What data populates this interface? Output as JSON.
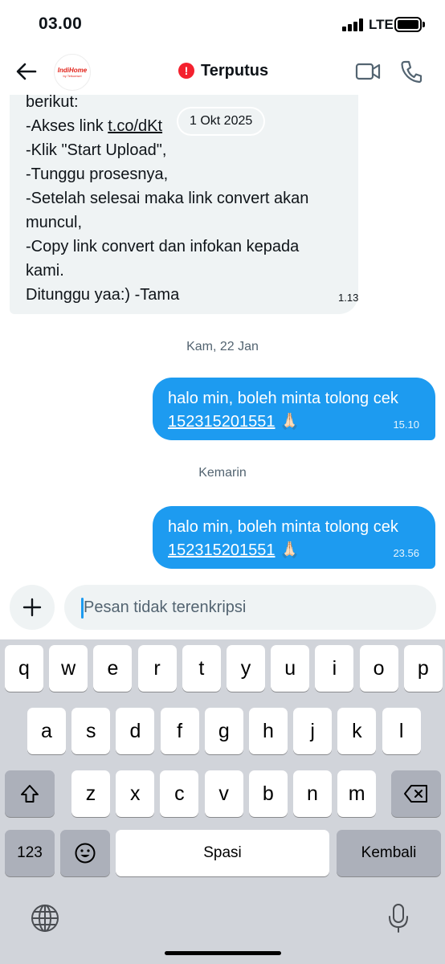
{
  "status_bar": {
    "time": "03.00",
    "network": "LTE"
  },
  "header": {
    "title": "Terputus",
    "avatar_brand": "IndiHome",
    "avatar_sub": "by Telkomsel",
    "back_icon": "arrow-left-icon",
    "video_icon": "video-camera-icon",
    "call_icon": "phone-icon",
    "status_color": "#f4212e"
  },
  "messages": {
    "incoming": {
      "lines": [
        "berikut:",
        "-Akses link ",
        "-Klik \"Start Upload\",",
        "-Tunggu prosesnya,",
        "-Setelah selesai maka link convert akan",
        "muncul,",
        "-Copy link convert dan infokan kepada",
        "kami.",
        "Ditunggu yaa:) -Tama"
      ],
      "link": "t.co/dKt",
      "time": "1.13"
    },
    "date_chip": "1 Okt 2025",
    "day1": "Kam, 22 Jan",
    "out1": {
      "text": "halo min, boleh minta tolong cek",
      "number": "152315201551",
      "emoji": "🙏🏻",
      "time": "15.10"
    },
    "day2": "Kemarin",
    "out2": {
      "text": "halo min, boleh minta tolong cek",
      "number": "152315201551",
      "emoji": "🙏🏻",
      "time": "23.56"
    }
  },
  "composer": {
    "placeholder": "Pesan tidak terenkripsi",
    "plus_icon": "plus-icon"
  },
  "keyboard": {
    "row1": [
      "q",
      "w",
      "e",
      "r",
      "t",
      "y",
      "u",
      "i",
      "o",
      "p"
    ],
    "row2": [
      "a",
      "s",
      "d",
      "f",
      "g",
      "h",
      "j",
      "k",
      "l"
    ],
    "row3": [
      "z",
      "x",
      "c",
      "v",
      "b",
      "n",
      "m"
    ],
    "numbers_key": "123",
    "space_key": "Spasi",
    "return_key": "Kembali",
    "shift_icon": "shift-icon",
    "backspace_icon": "backspace-icon",
    "emoji_icon": "emoji-icon",
    "globe_icon": "globe-icon",
    "mic_icon": "microphone-icon"
  },
  "colors": {
    "accent": "#1d9bf0",
    "bubble_in": "#eff3f4",
    "keyboard_bg": "#d1d4da"
  }
}
